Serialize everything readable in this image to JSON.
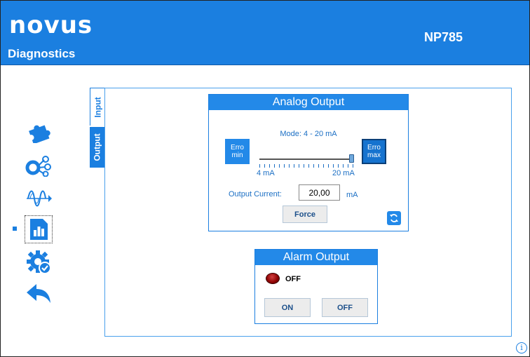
{
  "header": {
    "logo": "novus",
    "page_title": "Diagnostics",
    "device": "NP785"
  },
  "sidebar": {
    "items": [
      {
        "icon": "puzzle-icon"
      },
      {
        "icon": "network-nodes-icon"
      },
      {
        "icon": "wave-arrow-icon"
      },
      {
        "icon": "bar-chart-icon",
        "selected": true
      },
      {
        "icon": "gear-check-icon"
      },
      {
        "icon": "back-arrow-icon"
      }
    ]
  },
  "tabs": {
    "input_label": "Input",
    "output_label": "Output",
    "active": "Output"
  },
  "analog_output": {
    "title": "Analog Output",
    "mode": "Mode: 4 - 20 mA",
    "erro_min_label": "Erro min",
    "erro_max_label": "Erro max",
    "scale_min": "4 mA",
    "scale_max": "20 mA",
    "slider_value_ma": 20,
    "current_label": "Output Current:",
    "current_value": "20,00",
    "current_unit": "mA",
    "force_label": "Force"
  },
  "alarm_output": {
    "title": "Alarm Output",
    "state": "OFF",
    "led_color": "#8b0000",
    "on_label": "ON",
    "off_label": "OFF"
  },
  "colors": {
    "accent": "#1b7fe0",
    "header": "#1b7fe0"
  }
}
